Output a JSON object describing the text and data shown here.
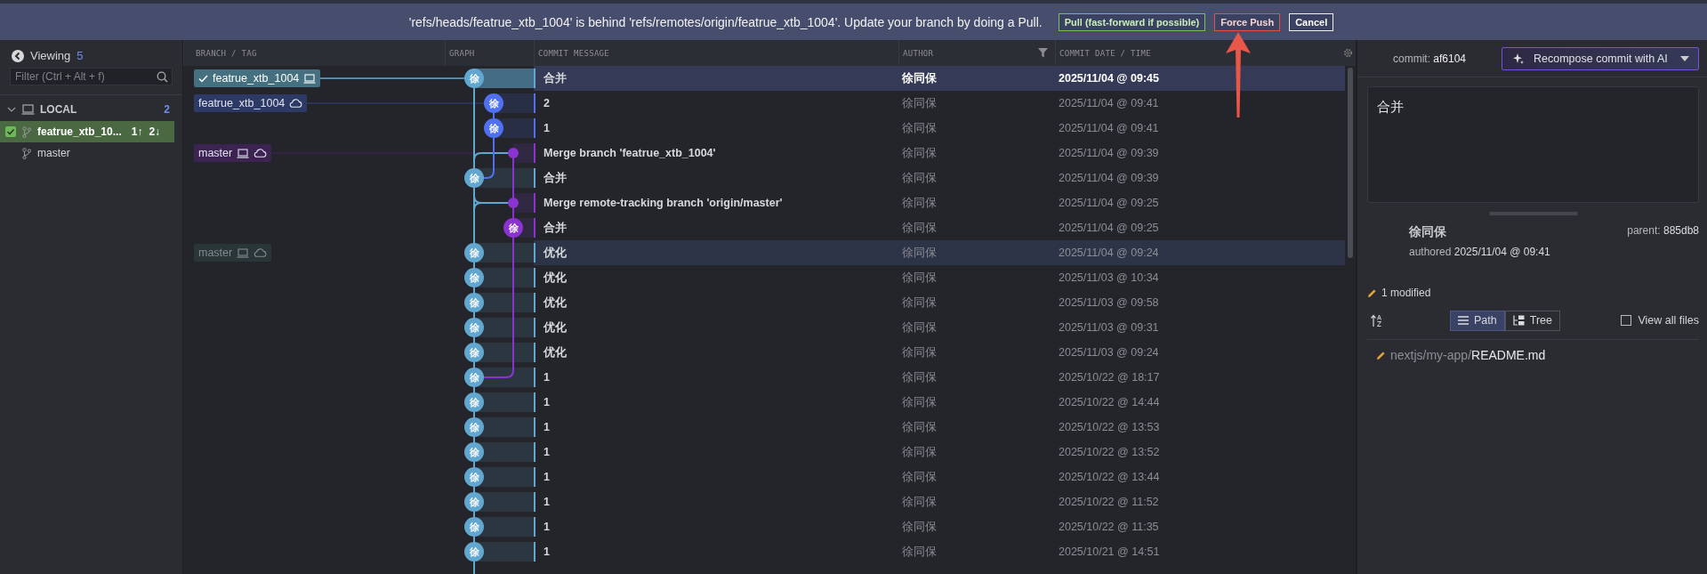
{
  "banner": {
    "message": "'refs/heads/featrue_xtb_1004' is behind 'refs/remotes/origin/featrue_xtb_1004'. Update your branch by doing a Pull.",
    "buttons": [
      {
        "label": "Pull (fast-forward if possible)",
        "kind": "pull"
      },
      {
        "label": "Force Push",
        "kind": "danger"
      },
      {
        "label": "Cancel",
        "kind": "cancel"
      }
    ]
  },
  "sidebar": {
    "viewing_label": "Viewing",
    "viewing_count": "5",
    "filter": {
      "placeholder": "Filter (Ctrl + Alt + f)"
    },
    "section": {
      "title": "LOCAL",
      "count": "2",
      "expanded": true
    },
    "branches": [
      {
        "name": "featrue_xtb_10...",
        "ahead": "1↑",
        "behind": "2↓",
        "selected": true,
        "checked": true
      },
      {
        "name": "master",
        "selected": false,
        "checked": false
      }
    ]
  },
  "columns": [
    {
      "label": "BRANCH / TAG",
      "filter": false
    },
    {
      "label": "GRAPH",
      "filter": false
    },
    {
      "label": "COMMIT MESSAGE",
      "filter": false
    },
    {
      "label": "AUTHOR",
      "filter": true
    },
    {
      "label": "COMMIT DATE / TIME",
      "filter": false
    }
  ],
  "rows": [
    {
      "message": "合并",
      "author": "徐同保",
      "date": "2025/11/04 @ 09:45",
      "color": "#62a7cf",
      "kind": "avatar",
      "initial": "徐",
      "selected": true,
      "highlighted": false,
      "refs": [
        {
          "name": "featrue_xtb_1004",
          "color": "#44707f",
          "current": true,
          "local": true,
          "remote": false,
          "dimmed": false
        }
      ]
    },
    {
      "message": "2",
      "author": "徐同保",
      "date": "2025/11/04 @ 09:41",
      "color": "#4f70f0",
      "kind": "avatar",
      "initial": "徐",
      "selected": false,
      "highlighted": false,
      "refs": [
        {
          "name": "featrue_xtb_1004",
          "color": "#2e3a66",
          "current": false,
          "local": false,
          "remote": true,
          "dimmed": false
        }
      ]
    },
    {
      "message": "1",
      "author": "徐同保",
      "date": "2025/11/04 @ 09:41",
      "color": "#4f70f0",
      "kind": "avatar",
      "initial": "徐",
      "selected": false,
      "highlighted": false
    },
    {
      "message": "Merge branch 'featrue_xtb_1004'",
      "author": "徐同保",
      "date": "2025/11/04 @ 09:39",
      "color": "#8b33d0",
      "kind": "dot",
      "selected": false,
      "highlighted": false,
      "refs": [
        {
          "name": "master",
          "color": "#3d2352",
          "current": false,
          "local": true,
          "remote": true,
          "dimmed": false
        }
      ]
    },
    {
      "message": "合并",
      "author": "徐同保",
      "date": "2025/11/04 @ 09:39",
      "color": "#62a7cf",
      "kind": "avatar",
      "initial": "徐",
      "selected": false,
      "highlighted": false
    },
    {
      "message": "Merge remote-tracking branch 'origin/master'",
      "author": "徐同保",
      "date": "2025/11/04 @ 09:25",
      "color": "#8b33d0",
      "kind": "dot",
      "selected": false,
      "highlighted": false
    },
    {
      "message": "合并",
      "author": "徐同保",
      "date": "2025/11/04 @ 09:25",
      "color": "#8b33d0",
      "kind": "avatar",
      "initial": "徐",
      "selected": false,
      "highlighted": false
    },
    {
      "message": "优化",
      "author": "徐同保",
      "date": "2025/11/04 @ 09:24",
      "color": "#62a7cf",
      "kind": "avatar",
      "initial": "徐",
      "selected": false,
      "highlighted": true,
      "refs": [
        {
          "name": "master",
          "color": "#2a3538",
          "current": false,
          "local": true,
          "remote": true,
          "dimmed": true
        }
      ]
    },
    {
      "message": "优化",
      "author": "徐同保",
      "date": "2025/11/03 @ 10:34",
      "color": "#62a7cf",
      "kind": "avatar",
      "initial": "徐",
      "selected": false,
      "highlighted": false
    },
    {
      "message": "优化",
      "author": "徐同保",
      "date": "2025/11/03 @ 09:58",
      "color": "#62a7cf",
      "kind": "avatar",
      "initial": "徐",
      "selected": false,
      "highlighted": false
    },
    {
      "message": "优化",
      "author": "徐同保",
      "date": "2025/11/03 @ 09:31",
      "color": "#62a7cf",
      "kind": "avatar",
      "initial": "徐",
      "selected": false,
      "highlighted": false
    },
    {
      "message": "优化",
      "author": "徐同保",
      "date": "2025/11/03 @ 09:24",
      "color": "#62a7cf",
      "kind": "avatar",
      "initial": "徐",
      "selected": false,
      "highlighted": false
    },
    {
      "message": "1",
      "author": "徐同保",
      "date": "2025/10/22 @ 18:17",
      "color": "#62a7cf",
      "kind": "avatar",
      "initial": "徐",
      "selected": false,
      "highlighted": false
    },
    {
      "message": "1",
      "author": "徐同保",
      "date": "2025/10/22 @ 14:44",
      "color": "#62a7cf",
      "kind": "avatar",
      "initial": "徐",
      "selected": false,
      "highlighted": false
    },
    {
      "message": "1",
      "author": "徐同保",
      "date": "2025/10/22 @ 13:53",
      "color": "#62a7cf",
      "kind": "avatar",
      "initial": "徐",
      "selected": false,
      "highlighted": false
    },
    {
      "message": "1",
      "author": "徐同保",
      "date": "2025/10/22 @ 13:52",
      "color": "#62a7cf",
      "kind": "avatar",
      "initial": "徐",
      "selected": false,
      "highlighted": false
    },
    {
      "message": "1",
      "author": "徐同保",
      "date": "2025/10/22 @ 13:44",
      "color": "#62a7cf",
      "kind": "avatar",
      "initial": "徐",
      "selected": false,
      "highlighted": false
    },
    {
      "message": "1",
      "author": "徐同保",
      "date": "2025/10/22 @ 11:52",
      "color": "#62a7cf",
      "kind": "avatar",
      "initial": "徐",
      "selected": false,
      "highlighted": false
    },
    {
      "message": "1",
      "author": "徐同保",
      "date": "2025/10/22 @ 11:35",
      "color": "#62a7cf",
      "kind": "avatar",
      "initial": "徐",
      "selected": false,
      "highlighted": false
    },
    {
      "message": "1",
      "author": "徐同保",
      "date": "2025/10/21 @ 14:51",
      "color": "#62a7cf",
      "kind": "avatar",
      "initial": "徐",
      "selected": false,
      "highlighted": false
    }
  ],
  "details": {
    "commit_label": "commit:",
    "commit_id": "af6104",
    "ai_button": "Recompose commit with AI",
    "message": "合并",
    "author": "徐同保",
    "authored_label": "authored",
    "authored_date": "2025/11/04 @ 09:41",
    "parent_label": "parent:",
    "parent_id": "885db8",
    "modified": "1 modified",
    "views": [
      {
        "label": "Path",
        "kind": "path",
        "selected": true
      },
      {
        "label": "Tree",
        "kind": "tree",
        "selected": false
      }
    ],
    "view_all": {
      "label": "View all files",
      "checked": false
    },
    "files": [
      {
        "dir": "nextjs/my-app/",
        "name": "README.md"
      }
    ]
  }
}
